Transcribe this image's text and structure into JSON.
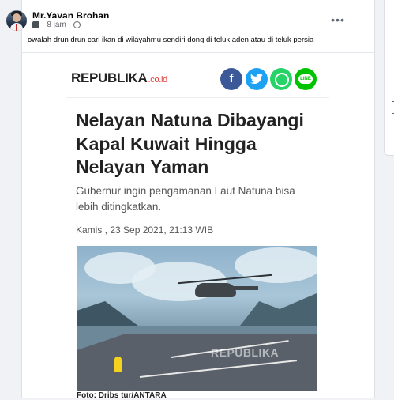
{
  "post": {
    "author": "Mr.Yayan Brohan",
    "time": "8 jam",
    "caption": "owalah drun drun cari ikan di wilayahmu sendiri dong di teluk aden atau di teluk persia",
    "more_icon": "more-horizontal-icon"
  },
  "article": {
    "logo": "REPUBLIKA",
    "logo_tld": ".co.id",
    "share": [
      {
        "icon": "facebook-icon",
        "glyph": "f",
        "color": "#3b5998"
      },
      {
        "icon": "twitter-icon",
        "glyph": "t",
        "color": "#1da1f2"
      },
      {
        "icon": "whatsapp-icon",
        "glyph": "",
        "color": "#25d366"
      },
      {
        "icon": "line-icon",
        "glyph": "LINE",
        "color": "#00c300"
      }
    ],
    "headline_line1": "Nelayan Natuna Dibayangi",
    "headline_line2": "Kapal Kuwait Hingga",
    "headline_line3": "Nelayan Yaman",
    "subtitle": "Gubernur ingin pengamanan Laut Natuna bisa lebih ditingkatkan.",
    "date": "Kamis , 23 Sep 2021, 21:13 WIB",
    "photo_watermark": "REPUBLIKA",
    "photo_credit": "Foto: Dribs tur/ANTARA"
  },
  "colors": {
    "page_bg": "#f0f2f5",
    "card_bg": "#ffffff",
    "logo_accent": "#e53935"
  }
}
